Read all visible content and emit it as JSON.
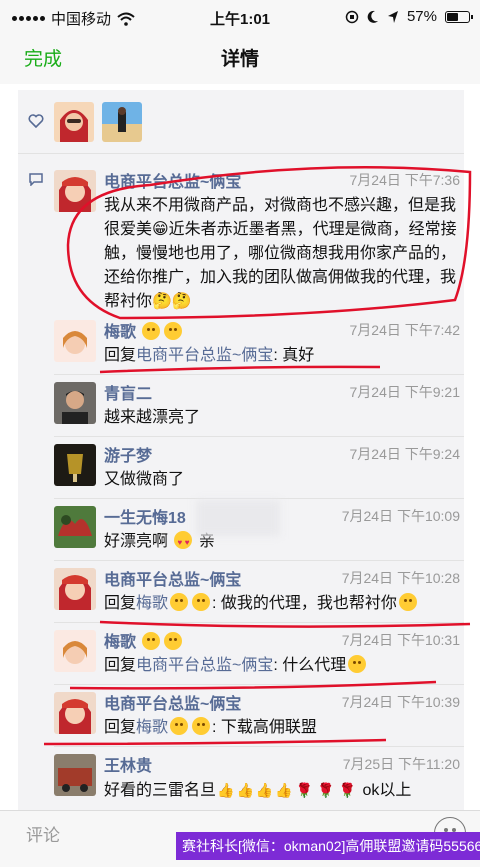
{
  "status_bar": {
    "carrier": "中国移动",
    "time": "上午1:01",
    "battery_text": "57%",
    "battery_level": 0.57,
    "icons": [
      "signal-icon",
      "wifi-icon",
      "moon-icon",
      "location-icon",
      "battery-icon"
    ]
  },
  "nav": {
    "done_label": "完成",
    "title": "详情"
  },
  "likes": {
    "icons": [
      "heart-icon"
    ]
  },
  "comments": [
    {
      "name": "电商平台总监~俩宝",
      "time": "7月24日 下午7:36",
      "text": "我从来不用微商产品，对微商也不感兴趣，但是我很爱美😁近朱者赤近墨者黑，代理是微商，经常接触，慢慢地也用了，哪位微商想我用你家产品的，还给你推广，加入我的团队做高佣做我的代理，我帮衬你🤔🤔"
    },
    {
      "name": "梅歌",
      "time": "7月24日 下午7:42",
      "reply_prefix": "回复",
      "reply_to": "电商平台总监~俩宝",
      "text": ": 真好"
    },
    {
      "name": "青盲二",
      "time": "7月24日 下午9:21",
      "text": "越来越漂亮了"
    },
    {
      "name": "游子梦",
      "time": "7月24日 下午9:24",
      "text": "又做微商了"
    },
    {
      "name": "一生无悔18",
      "time": "7月24日 下午10:09",
      "text": "好漂亮啊",
      "text_after": "亲"
    },
    {
      "name": "电商平台总监~俩宝",
      "time": "7月24日 下午10:28",
      "reply_prefix": "回复",
      "reply_to": "梅歌",
      "text": ": 做我的代理，我也帮衬你"
    },
    {
      "name": "梅歌",
      "time": "7月24日 下午10:31",
      "reply_prefix": "回复",
      "reply_to": "电商平台总监~俩宝",
      "text": ": 什么代理"
    },
    {
      "name": "电商平台总监~俩宝",
      "time": "7月24日 下午10:39",
      "reply_prefix": "回复",
      "reply_to": "梅歌",
      "text": ": 下载高佣联盟"
    },
    {
      "name": "王林贵",
      "time": "7月25日 下午11:20",
      "text": "好看的三雷名旦",
      "text_after": "ok以上"
    }
  ],
  "footer": {
    "placeholder": "评论"
  },
  "banner": {
    "text": "赛社科长[微信：okman02]高佣联盟邀请码555666"
  },
  "colors": {
    "accent_green": "#1aad19",
    "link_blue": "#576b95",
    "banner_purple": "#7d2bd6",
    "ink_red": "#e0102a"
  }
}
